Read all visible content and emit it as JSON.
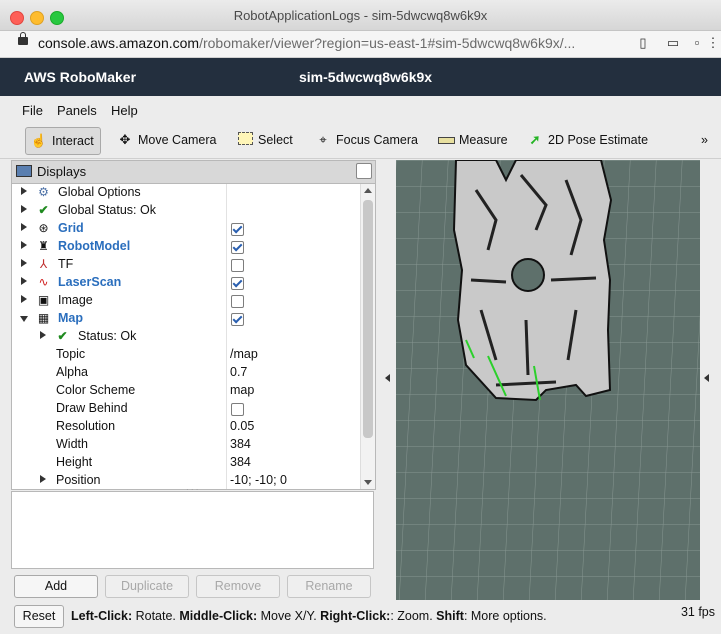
{
  "window": {
    "title": "RobotApplicationLogs - sim-5dwcwq8w6k9x",
    "url_host": "console.aws.amazon.com",
    "url_path": "/robomaker/viewer?region=us-east-1#sim-5dwcwq8w6k9x/..."
  },
  "aws": {
    "brand": "AWS RoboMaker",
    "sim_name": "sim-5dwcwq8w6k9x"
  },
  "menu": {
    "file": "File",
    "panels": "Panels",
    "help": "Help"
  },
  "toolbar": {
    "interact": "Interact",
    "move_camera": "Move Camera",
    "select": "Select",
    "focus_camera": "Focus Camera",
    "measure": "Measure",
    "pose_estimate": "2D Pose Estimate",
    "overflow": "»"
  },
  "displays": {
    "title": "Displays",
    "items": [
      {
        "label": "Global Options",
        "icon": "gear-icon"
      },
      {
        "label": "Global Status: Ok",
        "icon": "check-icon"
      },
      {
        "label": "Grid",
        "icon": "grid-icon",
        "checked": true
      },
      {
        "label": "RobotModel",
        "icon": "robot-icon",
        "checked": true
      },
      {
        "label": "TF",
        "icon": "axes-icon",
        "checked": false
      },
      {
        "label": "LaserScan",
        "icon": "laser-icon",
        "checked": true
      },
      {
        "label": "Image",
        "icon": "image-icon",
        "checked": false
      },
      {
        "label": "Map",
        "icon": "map-icon",
        "checked": true
      }
    ],
    "map_children": {
      "status": "Status: Ok",
      "topic_label": "Topic",
      "topic": "/map",
      "alpha_label": "Alpha",
      "alpha": "0.7",
      "scheme_label": "Color Scheme",
      "scheme": "map",
      "draw_behind_label": "Draw Behind",
      "draw_behind": false,
      "resolution_label": "Resolution",
      "resolution": "0.05",
      "width_label": "Width",
      "width": "384",
      "height_label": "Height",
      "height": "384",
      "position_label": "Position",
      "position": "-10; -10; 0"
    }
  },
  "buttons": {
    "add": "Add",
    "duplicate": "Duplicate",
    "remove": "Remove",
    "rename": "Rename",
    "reset": "Reset"
  },
  "status": {
    "left_click_key": "Left-Click:",
    "left_click": " Rotate. ",
    "middle_click_key": "Middle-Click:",
    "middle_click": " Move X/Y. ",
    "right_click_key": "Right-Click:",
    "right_click": ": Zoom. ",
    "shift_key": "Shift",
    "shift": ": More options.",
    "fps": "31 fps"
  },
  "colors": {
    "aws_bar": "#232f3e",
    "viewport_bg": "#5e706b",
    "highlight_text": "#2a6ebd"
  }
}
